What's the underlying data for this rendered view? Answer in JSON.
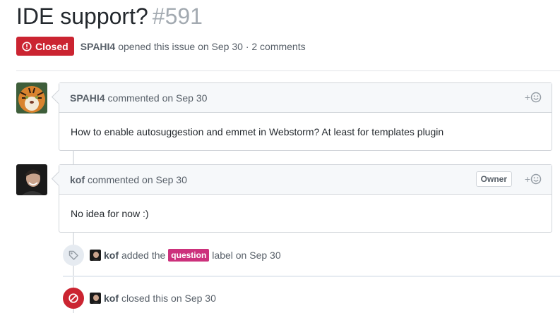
{
  "issue": {
    "title": "IDE support?",
    "number": "#591",
    "state": "Closed",
    "author": "SPAHI4",
    "meta_text": "opened this issue on Sep 30 · 2 comments"
  },
  "comments": [
    {
      "author": "SPAHI4",
      "action": "commented on Sep 30",
      "body": "How to enable autosuggestion and emmet in Webstorm? At least for templates plugin",
      "reaction": "+"
    },
    {
      "author": "kof",
      "action": "commented on Sep 30",
      "badge": "Owner",
      "body": "No idea for now :)",
      "reaction": "+"
    }
  ],
  "events": [
    {
      "actor": "kof",
      "pre_text": "added the",
      "label": "question",
      "post_text": "label on Sep 30",
      "icon": "tag-icon"
    },
    {
      "actor": "kof",
      "text": "closed this on Sep 30",
      "icon": "circle-slash-icon"
    }
  ],
  "colors": {
    "closed_red": "#cb2431",
    "label_question": "#cc317c"
  }
}
